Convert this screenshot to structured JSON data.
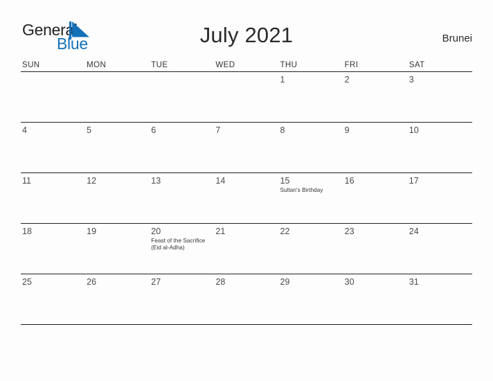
{
  "brand": {
    "name_part1": "General",
    "name_part2": "Blue",
    "flag_icon": "blue-triangle-flag-icon",
    "colors": {
      "text_dark": "#231f20",
      "accent_blue": "#1471b8"
    }
  },
  "header": {
    "title": "July 2021",
    "region": "Brunei"
  },
  "calendar": {
    "weekdays": [
      "SUN",
      "MON",
      "TUE",
      "WED",
      "THU",
      "FRI",
      "SAT"
    ],
    "weeks": [
      [
        {
          "day": "",
          "events": []
        },
        {
          "day": "",
          "events": []
        },
        {
          "day": "",
          "events": []
        },
        {
          "day": "",
          "events": []
        },
        {
          "day": "1",
          "events": []
        },
        {
          "day": "2",
          "events": []
        },
        {
          "day": "3",
          "events": []
        }
      ],
      [
        {
          "day": "4",
          "events": []
        },
        {
          "day": "5",
          "events": []
        },
        {
          "day": "6",
          "events": []
        },
        {
          "day": "7",
          "events": []
        },
        {
          "day": "8",
          "events": []
        },
        {
          "day": "9",
          "events": []
        },
        {
          "day": "10",
          "events": []
        }
      ],
      [
        {
          "day": "11",
          "events": []
        },
        {
          "day": "12",
          "events": []
        },
        {
          "day": "13",
          "events": []
        },
        {
          "day": "14",
          "events": []
        },
        {
          "day": "15",
          "events": [
            "Sultan's Birthday"
          ]
        },
        {
          "day": "16",
          "events": []
        },
        {
          "day": "17",
          "events": []
        }
      ],
      [
        {
          "day": "18",
          "events": []
        },
        {
          "day": "19",
          "events": []
        },
        {
          "day": "20",
          "events": [
            "Feast of the Sacrifice (Eid al-Adha)"
          ]
        },
        {
          "day": "21",
          "events": []
        },
        {
          "day": "22",
          "events": []
        },
        {
          "day": "23",
          "events": []
        },
        {
          "day": "24",
          "events": []
        }
      ],
      [
        {
          "day": "25",
          "events": []
        },
        {
          "day": "26",
          "events": []
        },
        {
          "day": "27",
          "events": []
        },
        {
          "day": "28",
          "events": []
        },
        {
          "day": "29",
          "events": []
        },
        {
          "day": "30",
          "events": []
        },
        {
          "day": "31",
          "events": []
        }
      ]
    ]
  }
}
